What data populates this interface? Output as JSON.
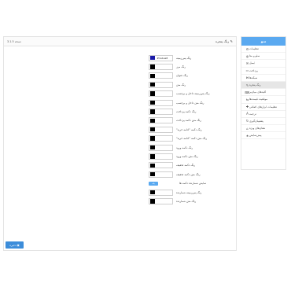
{
  "sidebar": {
    "header": "منو",
    "items": [
      {
        "label": "تنظیمات",
        "icon": "gear-icon",
        "glyph": "⚙"
      },
      {
        "label": "سئو و متا",
        "icon": "globe-icon",
        "glyph": "◍"
      },
      {
        "label": "ایمیل",
        "icon": "envelope-icon",
        "glyph": "✉"
      },
      {
        "label": "پرداخت",
        "icon": "card-icon",
        "glyph": "▭"
      },
      {
        "label": "شبکه‌ها",
        "icon": "share-icon",
        "glyph": "⋈"
      },
      {
        "label": "رنگ پنجره",
        "icon": "pencil-icon",
        "glyph": "✎",
        "active": true
      },
      {
        "label": "کلیدهای میان‌بر",
        "icon": "keyboard-icon",
        "glyph": "⌨"
      },
      {
        "label": "موقعیت قیمت‌ها",
        "icon": "arrows-icon",
        "glyph": "⇆"
      },
      {
        "label": "تنظیمات ابزارهای اضافی",
        "icon": "puzzle-icon",
        "glyph": "✚"
      },
      {
        "label": "ترجمه",
        "icon": "translate-icon",
        "glyph": "A"
      },
      {
        "label": "پشتیبان‌گیری",
        "icon": "refresh-icon",
        "glyph": "↻"
      },
      {
        "label": "نشان‌های ویژه",
        "icon": "tag-icon",
        "glyph": "⌂"
      },
      {
        "label": "پیش‌نمایش",
        "icon": "star-icon",
        "glyph": "★"
      }
    ]
  },
  "panel": {
    "title": "رنگ پنجره",
    "title_icon": "pencil-icon",
    "version": "نسخه 3.1.5",
    "rows": [
      {
        "label": "رنگ پس‌زمینه",
        "type": "color",
        "color": "#1a1aa8",
        "hex": "#1a1aa8"
      },
      {
        "label": "رنگ مرز",
        "type": "color",
        "color": "#000000"
      },
      {
        "label": "رنگ عنوان",
        "type": "color",
        "color": "#000000"
      },
      {
        "label": "رنگ متن",
        "type": "color",
        "color": "#000000"
      },
      {
        "label": "رنگ پس‌زمینه داخل و برچسب",
        "type": "color",
        "color": "#000000"
      },
      {
        "label": "رنگ متن داخل و برچسب",
        "type": "color",
        "color": "#000000"
      },
      {
        "label": "رنگ دکمه پرداخت",
        "type": "color",
        "color": "#000000"
      },
      {
        "label": "رنگ متن دکمه پرداخت",
        "type": "color",
        "color": "#000000"
      },
      {
        "label": "رنگ دکمه \"ادامه خرید\"",
        "type": "color",
        "color": "#000000"
      },
      {
        "label": "رنگ متن دکمه \"ادامه خرید\"",
        "type": "color",
        "color": "#000000"
      },
      {
        "label": "رنگ دکمه ورود",
        "type": "color",
        "color": "#000000"
      },
      {
        "label": "رنگ متن دکمه ورود",
        "type": "color",
        "color": "#000000"
      },
      {
        "label": "رنگ دکمه تخفیف",
        "type": "color",
        "color": "#000000"
      },
      {
        "label": "رنگ متن دکمه تخفیف",
        "type": "color",
        "color": "#000000"
      },
      {
        "label": "نمایش شمارنده دکمه ها",
        "type": "toggle",
        "value": "بله"
      },
      {
        "label": "رنگ پس‌زمینه شمارنده",
        "type": "color",
        "color": "#000000"
      },
      {
        "label": "رنگ متن شمارنده",
        "type": "color",
        "color": "#000000"
      }
    ]
  },
  "save_button": {
    "label": "ذخیره",
    "icon": "save-icon"
  }
}
